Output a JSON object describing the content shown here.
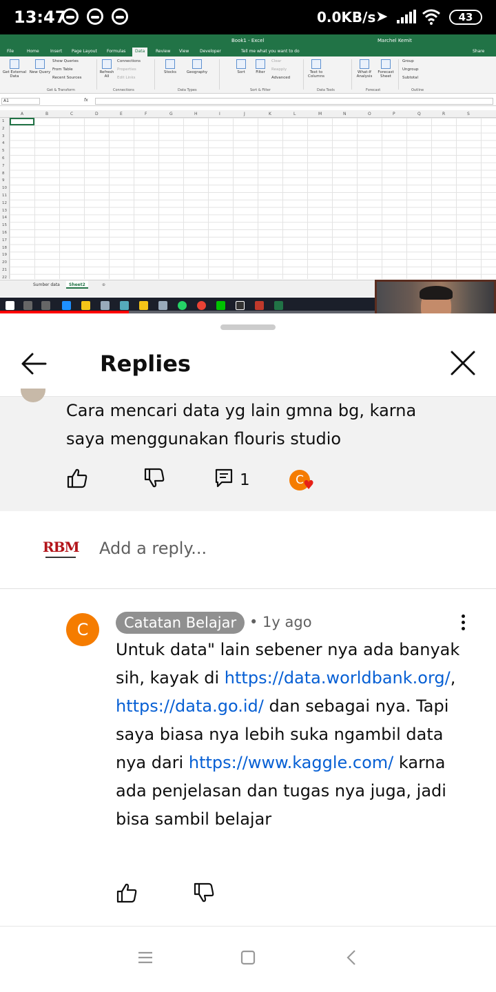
{
  "status_bar": {
    "time": "13:47",
    "network_speed": "0.0KB/s",
    "battery": "43"
  },
  "video": {
    "excel": {
      "doc_title": "Book1 - Excel",
      "user": "Marchel Kemit",
      "tabs": [
        "File",
        "Home",
        "Insert",
        "Page Layout",
        "Formulas",
        "Data",
        "Review",
        "View",
        "Developer",
        "Tell me what you want to do",
        "Share"
      ],
      "active_tab": "Data",
      "ribbon": {
        "get_external_data": "Get External Data",
        "new_query": "New Query",
        "show_queries": "Show Queries",
        "from_table": "From Table",
        "recent_sources": "Recent Sources",
        "refresh_all": "Refresh All",
        "connections": "Connections",
        "properties": "Properties",
        "edit_links": "Edit Links",
        "stocks": "Stocks",
        "geography": "Geography",
        "sort": "Sort",
        "filter": "Filter",
        "clear": "Clear",
        "reapply": "Reapply",
        "advanced": "Advanced",
        "text_to_columns": "Text to Columns",
        "what_if": "What-If Analysis",
        "forecast_sheet": "Forecast Sheet",
        "group": "Group",
        "ungroup": "Ungroup",
        "subtotal": "Subtotal",
        "groups": [
          "Get & Transform",
          "Connections",
          "Data Types",
          "Sort & Filter",
          "Data Tools",
          "Forecast",
          "Outline"
        ]
      },
      "name_box": "A1",
      "fx": "fx",
      "columns": [
        "A",
        "B",
        "C",
        "D",
        "E",
        "F",
        "G",
        "H",
        "I",
        "J",
        "K",
        "L",
        "M",
        "N",
        "O",
        "P",
        "Q",
        "R",
        "S"
      ],
      "rows": [
        "1",
        "2",
        "3",
        "4",
        "5",
        "6",
        "7",
        "8",
        "9",
        "10",
        "11",
        "12",
        "13",
        "14",
        "15",
        "16",
        "17",
        "18",
        "19",
        "20",
        "21",
        "22"
      ],
      "sheets": [
        "Sumber data",
        "Sheet2"
      ],
      "active_sheet": "Sheet2"
    },
    "progress_fraction": 0.26
  },
  "sheet": {
    "title": "Replies",
    "parent_comment": {
      "text": "Cara mencari data yg lain gmna bg,  karna saya menggunakan flouris studio",
      "reply_count": "1",
      "creator_heart_initial": "C"
    },
    "add_reply": {
      "logo_text": "RBM",
      "placeholder": "Add a reply..."
    },
    "reply": {
      "avatar_initial": "C",
      "author": "Catatan Belajar",
      "time": "• 1y ago",
      "text_parts": [
        {
          "type": "text",
          "value": "Untuk data\" lain sebener nya ada banyak sih, kayak di "
        },
        {
          "type": "link",
          "value": "https://data.worldbank.org/"
        },
        {
          "type": "text",
          "value": ", "
        },
        {
          "type": "link",
          "value": "https://data.go.id/"
        },
        {
          "type": "text",
          "value": " dan sebagai nya. Tapi saya biasa nya lebih suka ngambil data nya dari "
        },
        {
          "type": "link",
          "value": "https://www.kaggle.com/"
        },
        {
          "type": "text",
          "value": " karna ada penjelasan dan tugas nya juga, jadi bisa sambil belajar"
        }
      ]
    }
  },
  "colors": {
    "excel_green": "#217346",
    "avatar_orange": "#f57c00",
    "link_blue": "#065fd4",
    "heart_red": "#e62117",
    "progress_red": "#ff0000"
  }
}
